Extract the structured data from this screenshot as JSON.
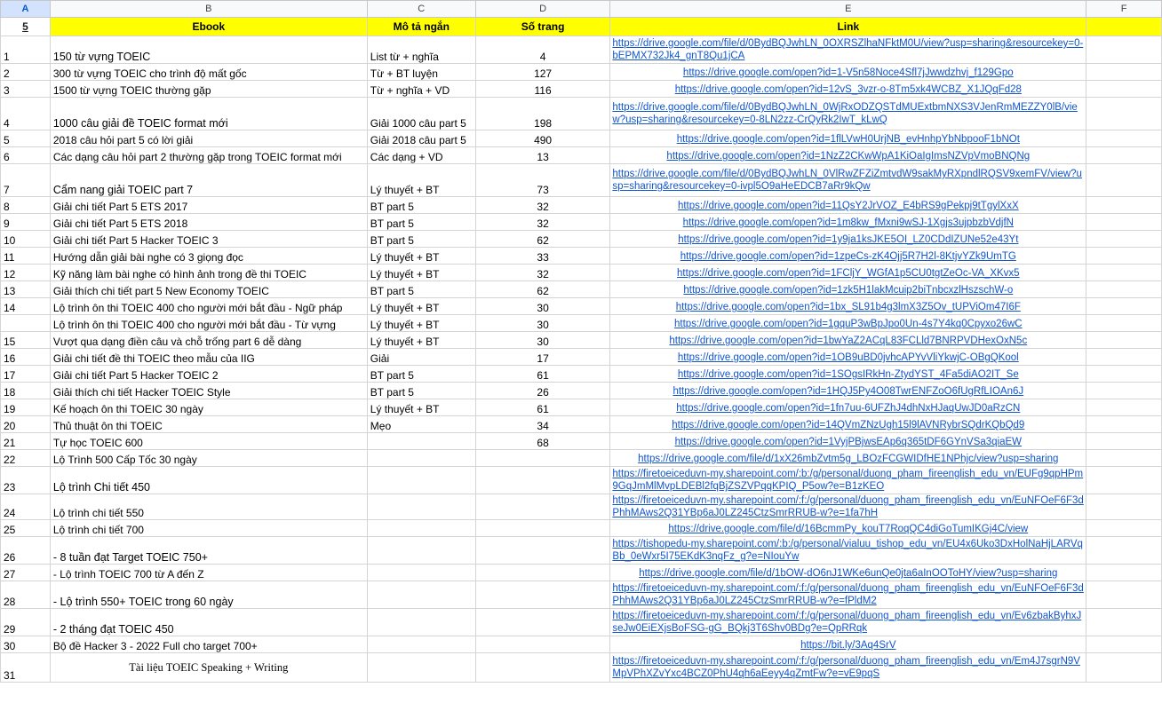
{
  "columns": [
    "A",
    "B",
    "C",
    "D",
    "E",
    "F"
  ],
  "header": {
    "row_label": "5",
    "ebook": "Ebook",
    "desc": "Mô tả ngắn",
    "pages": "Số trang",
    "link": "Link"
  },
  "rows": [
    {
      "n": "1",
      "title": "150 từ vựng TOEIC",
      "desc": "List từ + nghĩa",
      "pages": "4",
      "link": "https://drive.google.com/file/d/0BydBQJwhLN_0OXRSZlhaNFktM0U/view?usp=sharing&resourcekey=0-bEPMX732Jk4_gnT8Qu1jCA"
    },
    {
      "n": "2",
      "title": "300 từ vựng TOEIC cho trình độ mất gốc",
      "desc": "Từ + BT luyện",
      "pages": "127",
      "link": "https://drive.google.com/open?id=1-V5n58Noce4Sfl7jJwwdzhvj_f129Gpo"
    },
    {
      "n": "3",
      "title": "1500 từ vựng TOEIC thường gặp",
      "desc": "Từ + nghĩa + VD",
      "pages": "116",
      "link": "https://drive.google.com/open?id=12vS_3vzr-o-8Tm5xk4WCBZ_X1JQqFd28"
    },
    {
      "n": "4",
      "title": "1000 câu giải đề TOEIC format mới",
      "desc": "Giải 1000 câu part 5",
      "pages": "198",
      "link": "https://drive.google.com/file/d/0BydBQJwhLN_0WjRxODZQSTdMUExtbmNXS3VJenRmMEZZY0lB/view?usp=sharing&resourcekey=0-8LN2zz-CrQyRk2IwT_kLwQ"
    },
    {
      "n": "5",
      "title": "2018 câu hỏi part 5 có lời giải",
      "desc": "Giải 2018 câu part 5",
      "pages": "490",
      "link": "https://drive.google.com/open?id=1flLVwH0UrjNB_evHnhpYbNbpooF1bNOt"
    },
    {
      "n": "6",
      "title": "Các dạng câu hỏi part 2 thường gặp trong TOEIC format mới",
      "desc": "Các dạng + VD",
      "pages": "13",
      "link": "https://drive.google.com/open?id=1NzZ2CKwWpA1KiOaIgImsNZVpVmoBNQNg"
    },
    {
      "n": "7",
      "title": "Cẩm nang giải TOEIC part 7",
      "desc": "Lý thuyết + BT",
      "pages": "73",
      "link": "https://drive.google.com/file/d/0BydBQJwhLN_0VlRwZFZiZmtvdW9sakMyRXpndlRQSV9xemFV/view?usp=sharing&resourcekey=0-ivpl5O9aHeEDCB7aRr9kQw"
    },
    {
      "n": "8",
      "title": "Giải chi tiết Part 5 ETS 2017",
      "desc": "BT part 5",
      "pages": "32",
      "link": "https://drive.google.com/open?id=11QsY2JrVOZ_E4bRS9gPekpj9tTgylXxX"
    },
    {
      "n": "9",
      "title": "Giải chi tiết Part 5 ETS 2018",
      "desc": "BT part 5",
      "pages": "32",
      "link": "https://drive.google.com/open?id=1m8kw_fMxni9wSJ-1Xgjs3ujpbzbVdjfN"
    },
    {
      "n": "10",
      "title": "Giải chi tiết Part 5 Hacker TOEIC 3",
      "desc": "BT part 5",
      "pages": "62",
      "link": "https://drive.google.com/open?id=1y9ja1ksJKE5OI_LZ0CDdIZUNe52e43Yt"
    },
    {
      "n": "11",
      "title": "Hướng dẫn giải bài nghe có 3 giọng đọc",
      "desc": "Lý thuyết + BT",
      "pages": "33",
      "link": "https://drive.google.com/open?id=1zpeCs-zK4Ojj5R7H2l-8KtjvYZk9UmTG"
    },
    {
      "n": "12",
      "title": "Kỹ năng làm bài nghe có hình ảnh trong đề thi TOEIC",
      "desc": "Lý thuyết + BT",
      "pages": "32",
      "link": "https://drive.google.com/open?id=1FCljY_WGfA1p5CU0tgtZeOc-VA_XKvx5"
    },
    {
      "n": "13",
      "title": "Giải thích chi tiết part 5 New Economy TOEIC",
      "desc": "BT part 5",
      "pages": "62",
      "link": "https://drive.google.com/open?id=1zk5H1lakMcuip2biTnbcxzlHszschW-o"
    },
    {
      "n": "14",
      "title": "Lộ trình ôn thi TOEIC 400 cho người mới bắt đầu - Ngữ pháp",
      "desc": "Lý thuyết + BT",
      "pages": "30",
      "link": "https://drive.google.com/open?id=1bx_SL91b4g3lmX3Z5Ov_tUPViOm47I6F"
    },
    {
      "n": "",
      "title": "Lộ trình ôn thi TOEIC 400 cho người mới bắt đầu - Từ vựng",
      "desc": "Lý thuyết + BT",
      "pages": "30",
      "link": "https://drive.google.com/open?id=1gquP3wBpJpo0Un-4s7Y4kq0Cpyxo26wC"
    },
    {
      "n": "15",
      "title": "Vượt qua dạng điền câu và chỗ trống part 6 dễ dàng",
      "desc": "Lý thuyết + BT",
      "pages": "30",
      "link": "https://drive.google.com/open?id=1bwYaZ2ACqL83FCLld7BNRPVDHexOxN5c"
    },
    {
      "n": "16",
      "title": "Giải chi tiết đề thi TOEIC theo mẫu của IIG",
      "desc": "Giải",
      "pages": "17",
      "link": "https://drive.google.com/open?id=1OB9uBD0jvhcAPYvVliYkwjC-OBgQKool"
    },
    {
      "n": "17",
      "title": "Giải chi tiết Part 5 Hacker TOEIC 2",
      "desc": "BT part 5",
      "pages": "61",
      "link": "https://drive.google.com/open?id=1SOgsIRkHn-ZtydYST_4Fa5diAO2IT_Se"
    },
    {
      "n": "18",
      "title": "Giải thích chi tiết Hacker TOEIC Style",
      "desc": "BT part 5",
      "pages": "26",
      "link": "https://drive.google.com/open?id=1HQJ5Py4O08TwrENFZoO6fUgRfLIOAn6J"
    },
    {
      "n": "19",
      "title": "Kế hoạch ôn thi TOEIC 30 ngày",
      "desc": "Lý thuyết + BT",
      "pages": "61",
      "link": "https://drive.google.com/open?id=1fn7uu-6UFZhJ4dhNxHJaqUwJD0aRzCN"
    },
    {
      "n": "20",
      "title": "Thủ thuật ôn thi TOEIC",
      "desc": "Mẹo",
      "pages": "34",
      "link": "https://drive.google.com/open?id=14QVmZNzUgh15l9lAVNRybrSQdrKQbQd9"
    },
    {
      "n": "21",
      "title": "Tự học TOEIC 600",
      "desc": "",
      "pages": "68",
      "link": "https://drive.google.com/open?id=1VyjPBjwsEAp6q365tDF6GYnVSa3qiaEW"
    },
    {
      "n": "22",
      "title": "Lộ Trình 500 Cấp Tốc  30 ngày",
      "desc": "",
      "pages": "",
      "link": "https://drive.google.com/file/d/1xX26mbZvtm5g_LBOzFCGWIDfHE1NPhjc/view?usp=sharing"
    },
    {
      "n": "23",
      "title": "Lộ trình Chi tiết 450",
      "desc": "",
      "pages": "",
      "link": "https://firetoeiceduvn-my.sharepoint.com/:b:/g/personal/duong_pham_fireenglish_edu_vn/EUFg9qpHPm9GqJmMlMvpLDEBl2fqBjZSZVPqqKPIQ_P5ow?e=B1zKEO"
    },
    {
      "n": "24",
      "title": "Lộ trình chi tiết 550",
      "desc": "",
      "pages": "",
      "link": "https://firetoeiceduvn-my.sharepoint.com/:f:/g/personal/duong_pham_fireenglish_edu_vn/EuNFOeF6F3dPhhMAws2Q31YBp6aJ0LZ245CtzSmrRRUB-w?e=1fa7hH"
    },
    {
      "n": "25",
      "title": "Lộ trình chi tiết 700",
      "desc": "",
      "pages": "",
      "link": "https://drive.google.com/file/d/16BcmmPy_kouT7RoqQC4diGoTumIKGj4C/view"
    },
    {
      "n": "26",
      "title": "- 8 tuần đạt Target TOEIC 750+",
      "desc": "",
      "pages": "",
      "link": "https://tishopedu-my.sharepoint.com/:b:/g/personal/vialuu_tishop_edu_vn/EU4x6Uko3DxHolNaHjLARVqBb_0eWxr5I75EKdK3nqFz_g?e=NIouYw"
    },
    {
      "n": "27",
      "title": "- Lộ trình TOEIC 700 từ A đến Z",
      "desc": "",
      "pages": "",
      "link": "https://drive.google.com/file/d/1bOW-dO6nJ1WKe6unQe0jta6aInOOToHY/view?usp=sharing"
    },
    {
      "n": "28",
      "title": "- Lộ trình 550+ TOEIC trong 60 ngày",
      "desc": "",
      "pages": "",
      "link": "https://firetoeiceduvn-my.sharepoint.com/:f:/g/personal/duong_pham_fireenglish_edu_vn/EuNFOeF6F3dPhhMAws2Q31YBp6aJ0LZ245CtzSmrRRUB-w?e=fPldM2"
    },
    {
      "n": "29",
      "title": "- 2 tháng đạt TOEIC 450",
      "desc": "",
      "pages": "",
      "link": "https://firetoeiceduvn-my.sharepoint.com/:f:/g/personal/duong_pham_fireenglish_edu_vn/Ev6zbakByhxJseJw0EiEXjsBoFSG-gG_BQkj3T6Shv0BDg?e=QpRRqk"
    },
    {
      "n": "30",
      "title": "Bộ đề Hacker 3 - 2022 Full cho target 700+",
      "desc": "",
      "pages": "",
      "link": "https://bit.ly/3Aq4SrV"
    },
    {
      "n": "31",
      "title": "Tài liệu TOEIC Speaking + Writing",
      "desc": "",
      "pages": "",
      "link": "https://firetoeiceduvn-my.sharepoint.com/:f:/g/personal/duong_pham_fireenglish_edu_vn/Em4J7sgrN9VMpVPhXZvYxc4BCZ0PhU4qh6aEeyy4qZmtFw?e=vE9pqS"
    }
  ]
}
